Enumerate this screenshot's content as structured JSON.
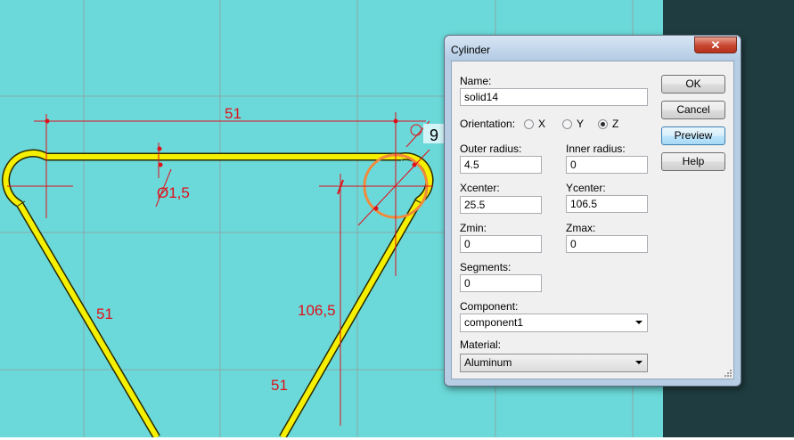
{
  "drawing": {
    "dimensions": {
      "top_length": "51",
      "radius_label": "9",
      "tube_diameter": "Ø1,5",
      "left_side_length": "51",
      "center_height": "106,5",
      "right_side_length": "51"
    },
    "colors": {
      "background": "#6bd9d9",
      "side_panel": "#1f3d40",
      "grid": "#8aa9a9",
      "tube_fill": "#f5ef00",
      "tube_edge": "#2a2a00",
      "dimension": "#e0101a",
      "selection": "#f08a3c"
    }
  },
  "dialog": {
    "title": "Cylinder",
    "close_label": "✕",
    "name_label": "Name:",
    "name_value": "solid14",
    "orientation_label": "Orientation:",
    "orientation_options": [
      "X",
      "Y",
      "Z"
    ],
    "orientation_selected": "Z",
    "outer_radius_label": "Outer radius:",
    "outer_radius_value": "4.5",
    "inner_radius_label": "Inner radius:",
    "inner_radius_value": "0",
    "xcenter_label": "Xcenter:",
    "xcenter_value": "25.5",
    "ycenter_label": "Ycenter:",
    "ycenter_value": "106.5",
    "zmin_label": "Zmin:",
    "zmin_value": "0",
    "zmax_label": "Zmax:",
    "zmax_value": "0",
    "segments_label": "Segments:",
    "segments_value": "0",
    "component_label": "Component:",
    "component_value": "component1",
    "material_label": "Material:",
    "material_value": "Aluminum",
    "buttons": {
      "ok": "OK",
      "cancel": "Cancel",
      "preview": "Preview",
      "help": "Help"
    }
  }
}
